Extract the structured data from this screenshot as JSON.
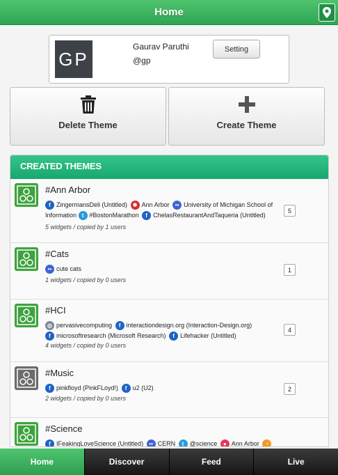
{
  "header": {
    "title": "Home",
    "map_icon": "map-pin-icon"
  },
  "profile": {
    "avatar_initials": "GP",
    "name": "Gaurav Paruthi",
    "handle": "@gp",
    "setting_label": "Setting"
  },
  "actions": {
    "delete": {
      "label": "Delete Theme",
      "icon": "trash-icon"
    },
    "create": {
      "label": "Create Theme",
      "icon": "plus-icon"
    }
  },
  "themes": {
    "header": "CREATED THEMES",
    "items": [
      {
        "name": "#Ann Arbor",
        "sources": [
          {
            "type": "facebook",
            "text": "ZingermansDeli (Untitled)"
          },
          {
            "type": "yelp",
            "text": "Ann Arbor"
          },
          {
            "type": "flickr",
            "text": "University of Michigan School of Information"
          },
          {
            "type": "twitter",
            "text": "#BostonMarathon"
          },
          {
            "type": "facebook",
            "text": "ChelasRestaurantAndTaqueria (Untitled)"
          }
        ],
        "meta": "5 widgets / copied by 1 users",
        "count": "5"
      },
      {
        "name": "#Cats",
        "sources": [
          {
            "type": "flickr",
            "text": "cute cats"
          }
        ],
        "meta": "1 widgets / copied by 0 users",
        "count": "1"
      },
      {
        "name": "#HCI",
        "sources": [
          {
            "type": "web",
            "text": "pervasivecomputing"
          },
          {
            "type": "facebook",
            "text": "interactiondesign.org (Interaction-Design.org)"
          },
          {
            "type": "facebook",
            "text": "microsoftresearch (Microsoft Research)"
          },
          {
            "type": "facebook",
            "text": "Lifehacker (Untitled)"
          }
        ],
        "meta": "4 widgets / copied by 0 users",
        "count": "4"
      },
      {
        "name": "#Music",
        "sources": [
          {
            "type": "facebook",
            "text": "pinkfloyd (PinkFLoyd!)"
          },
          {
            "type": "facebook",
            "text": "u2 (U2)"
          }
        ],
        "meta": "2 widgets / copied by 0 users",
        "count": "2"
      },
      {
        "name": "#Science",
        "sources": [
          {
            "type": "facebook",
            "text": "IFeakingLoveScience (Untitled)"
          },
          {
            "type": "flickr",
            "text": "CERN"
          },
          {
            "type": "twitter",
            "text": "@science"
          },
          {
            "type": "instagram",
            "text": "Ann Arbor"
          },
          {
            "type": "rss",
            "text": ""
          }
        ],
        "meta": "",
        "count": ""
      }
    ]
  },
  "tabs": [
    {
      "label": "Home",
      "active": true
    },
    {
      "label": "Discover",
      "active": false
    },
    {
      "label": "Feed",
      "active": false
    },
    {
      "label": "Live",
      "active": false
    }
  ],
  "colors": {
    "accent": "#2fa553",
    "facebook": "#1f63c6",
    "twitter": "#2a9ad9",
    "yelp": "#d92b2b",
    "flickr": "#3f63d6",
    "instagram": "#e5365a",
    "rss": "#f39a1e",
    "web": "#7a8796"
  }
}
